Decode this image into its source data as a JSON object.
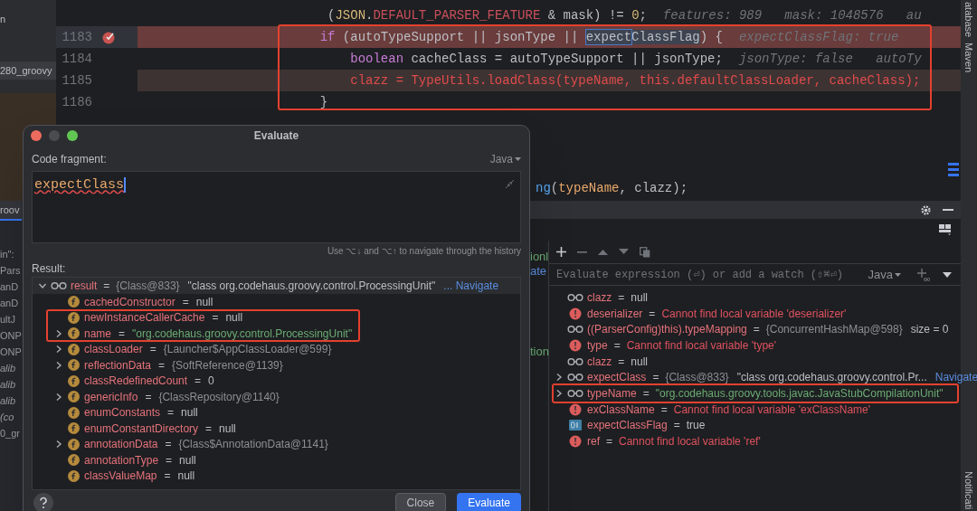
{
  "sidebar": {
    "items": [
      {
        "text": "n",
        "selected": false
      },
      {
        "text": "280_groovy",
        "selected": true
      }
    ]
  },
  "frames": {
    "tab": {
      "label": "roov",
      "selected": true
    },
    "items": [
      {
        "text": "in\":",
        "italic": false
      },
      {
        "text": "Pars",
        "italic": false
      },
      {
        "text": "anD",
        "italic": false
      },
      {
        "text": "anD",
        "italic": false
      },
      {
        "text": "ultJ",
        "italic": false
      },
      {
        "text": "ONP",
        "italic": false
      },
      {
        "text": "ONP",
        "italic": false
      },
      {
        "text": "alib",
        "italic": true
      },
      {
        "text": "alib",
        "italic": true
      },
      {
        "text": "alib",
        "italic": true
      },
      {
        "text": "(co",
        "italic": true
      },
      {
        "text": "0_gr",
        "italic": false
      }
    ],
    "fragments": [
      {
        "text": "ionl",
        "kind": "string"
      },
      {
        "text": "ate",
        "kind": "link"
      },
      {
        "text": "tion",
        "kind": "string"
      }
    ]
  },
  "editor": {
    "lines": [
      {
        "kind": "plain",
        "tokens": [
          {
            "text": "(",
            "kind": "plain"
          },
          {
            "text": "JSON",
            "kind": "class"
          },
          {
            "text": ".",
            "kind": "plain"
          },
          {
            "text": "DEFAULT_PARSER_FEATURE",
            "kind": "constant"
          },
          {
            "text": " & mask) != ",
            "kind": "plain"
          },
          {
            "text": "0",
            "kind": "number"
          },
          {
            "text": ";",
            "kind": "plain"
          }
        ],
        "hint": "features: 989   mask: 1048576   au"
      },
      {
        "kind": "breakpoint",
        "number": "1183",
        "tokens": [
          {
            "text": "if",
            "kind": "keyword"
          },
          {
            "text": " (autoTypeSupport || jsonType || ",
            "kind": "plain"
          },
          {
            "text": "expect",
            "kind": "caret-word"
          },
          {
            "text": "ClassFlag",
            "kind": "selected"
          },
          {
            "text": ") {",
            "kind": "plain"
          }
        ],
        "hint": "expectClassFlag: true"
      },
      {
        "kind": "plain",
        "number": "1184",
        "tokens": [
          {
            "text": "boolean",
            "kind": "keyword"
          },
          {
            "text": " cacheClass = autoTypeSupport || jsonType;",
            "kind": "plain"
          }
        ],
        "hint": "jsonType: false   autoTy"
      },
      {
        "kind": "error",
        "number": "1185",
        "tokens": [
          {
            "text": "clazz = TypeUtils.loadClass(typeName, this.defaultClassLoader, cacheClass);",
            "kind": "error"
          }
        ]
      },
      {
        "kind": "plain",
        "number": "1186",
        "tokens": [
          {
            "text": "}",
            "kind": "plain"
          }
        ]
      }
    ],
    "partial_line": [
      {
        "text": "ng",
        "kind": "method"
      },
      {
        "text": "(",
        "kind": "plain"
      },
      {
        "text": "typeName",
        "kind": "param"
      },
      {
        "text": ", clazz);",
        "kind": "plain"
      }
    ]
  },
  "tool_strip": {
    "top": [
      "atabase",
      "Maven"
    ],
    "bottom": "Notificati"
  },
  "watches": {
    "placeholder": "Evaluate expression (⏎) or add a watch (⇧⌘⏎)",
    "language": "Java",
    "rows": [
      {
        "kind": "watch",
        "name": "clazz",
        "value": [
          {
            "text": "=",
            "kind": "plain"
          },
          {
            "text": "null",
            "kind": "plain"
          }
        ],
        "expandable": false
      },
      {
        "kind": "error",
        "name": "deserializer",
        "value": [
          {
            "text": "=",
            "kind": "plain"
          },
          {
            "text": "Cannot find local variable 'deserializer'",
            "kind": "error"
          }
        ],
        "expandable": false
      },
      {
        "kind": "watch",
        "name": "((ParserConfig)this).typeMapping",
        "value": [
          {
            "text": "=",
            "kind": "plain"
          },
          {
            "text": "{ConcurrentHashMap@598}",
            "kind": "ref"
          },
          {
            "text": "size = 0",
            "kind": "plain"
          }
        ],
        "expandable": false
      },
      {
        "kind": "error",
        "name": "type",
        "value": [
          {
            "text": "=",
            "kind": "plain"
          },
          {
            "text": "Cannot find local variable 'type'",
            "kind": "error"
          }
        ],
        "expandable": false
      },
      {
        "kind": "watch",
        "name": "clazz",
        "value": [
          {
            "text": "=",
            "kind": "plain"
          },
          {
            "text": "null",
            "kind": "plain"
          }
        ],
        "expandable": false
      },
      {
        "kind": "watch",
        "name": "expectClass",
        "value": [
          {
            "text": "=",
            "kind": "plain"
          },
          {
            "text": "{Class@833}",
            "kind": "ref"
          },
          {
            "text": "\"class org.codehaus.groovy.control.Pr...",
            "kind": "plain"
          },
          {
            "text": "Navigate",
            "kind": "link"
          }
        ],
        "expandable": true
      },
      {
        "kind": "watch",
        "name": "typeName",
        "value": [
          {
            "text": "=",
            "kind": "plain"
          },
          {
            "text": "\"org.codehaus.groovy.tools.javac.JavaStubCompilationUnit\"",
            "kind": "string"
          }
        ],
        "expandable": true
      },
      {
        "kind": "error",
        "name": "exClassName",
        "value": [
          {
            "text": "=",
            "kind": "plain"
          },
          {
            "text": "Cannot find local variable 'exClassName'",
            "kind": "error"
          }
        ],
        "expandable": false
      },
      {
        "kind": "boolean",
        "name": "expectClassFlag",
        "value": [
          {
            "text": "=",
            "kind": "plain"
          },
          {
            "text": "true",
            "kind": "plain"
          }
        ],
        "expandable": false
      },
      {
        "kind": "error",
        "name": "ref",
        "value": [
          {
            "text": "=",
            "kind": "plain"
          },
          {
            "text": "Cannot find local variable 'ref'",
            "kind": "error"
          }
        ],
        "expandable": false
      }
    ]
  },
  "dialog": {
    "title": "Evaluate",
    "label": "Code fragment:",
    "language": "Java",
    "code": "expectClass",
    "history_hint": "Use ⌥↓ and ⌥↑ to navigate through the history",
    "result_label": "Result:",
    "result": {
      "name": "result",
      "expanded": true,
      "value": [
        {
          "text": "=",
          "kind": "plain"
        },
        {
          "text": "{Class@833}",
          "kind": "ref"
        },
        {
          "text": "\"class org.codehaus.groovy.control.ProcessingUnit\"",
          "kind": "plain"
        },
        {
          "text": "... Navigate",
          "kind": "link"
        }
      ],
      "children": [
        {
          "name": "cachedConstructor",
          "value": [
            {
              "text": "=",
              "kind": "plain"
            },
            {
              "text": "null",
              "kind": "plain"
            }
          ],
          "expandable": false
        },
        {
          "name": "newInstanceCallerCache",
          "value": [
            {
              "text": "=",
              "kind": "plain"
            },
            {
              "text": "null",
              "kind": "plain"
            }
          ],
          "expandable": false
        },
        {
          "name": "name",
          "value": [
            {
              "text": "=",
              "kind": "plain"
            },
            {
              "text": "\"org.codehaus.groovy.control.ProcessingUnit\"",
              "kind": "string"
            }
          ],
          "expandable": true
        },
        {
          "name": "classLoader",
          "value": [
            {
              "text": "=",
              "kind": "plain"
            },
            {
              "text": "{Launcher$AppClassLoader@599}",
              "kind": "ref"
            }
          ],
          "expandable": true
        },
        {
          "name": "reflectionData",
          "value": [
            {
              "text": "=",
              "kind": "plain"
            },
            {
              "text": "{SoftReference@1139}",
              "kind": "ref"
            }
          ],
          "expandable": true
        },
        {
          "name": "classRedefinedCount",
          "value": [
            {
              "text": "=",
              "kind": "plain"
            },
            {
              "text": "0",
              "kind": "plain"
            }
          ],
          "expandable": false
        },
        {
          "name": "genericInfo",
          "value": [
            {
              "text": "=",
              "kind": "plain"
            },
            {
              "text": "{ClassRepository@1140}",
              "kind": "ref"
            }
          ],
          "expandable": true
        },
        {
          "name": "enumConstants",
          "value": [
            {
              "text": "=",
              "kind": "plain"
            },
            {
              "text": "null",
              "kind": "plain"
            }
          ],
          "expandable": false
        },
        {
          "name": "enumConstantDirectory",
          "value": [
            {
              "text": "=",
              "kind": "plain"
            },
            {
              "text": "null",
              "kind": "plain"
            }
          ],
          "expandable": false
        },
        {
          "name": "annotationData",
          "value": [
            {
              "text": "=",
              "kind": "plain"
            },
            {
              "text": "{Class$AnnotationData@1141}",
              "kind": "ref"
            }
          ],
          "expandable": true
        },
        {
          "name": "annotationType",
          "value": [
            {
              "text": "=",
              "kind": "plain"
            },
            {
              "text": "null",
              "kind": "plain"
            }
          ],
          "expandable": false
        },
        {
          "name": "classValueMap",
          "value": [
            {
              "text": "=",
              "kind": "plain"
            },
            {
              "text": "null",
              "kind": "plain"
            }
          ],
          "expandable": false
        }
      ]
    },
    "buttons": [
      {
        "label": "Close",
        "primary": false
      },
      {
        "label": "Evaluate",
        "primary": true
      }
    ]
  }
}
